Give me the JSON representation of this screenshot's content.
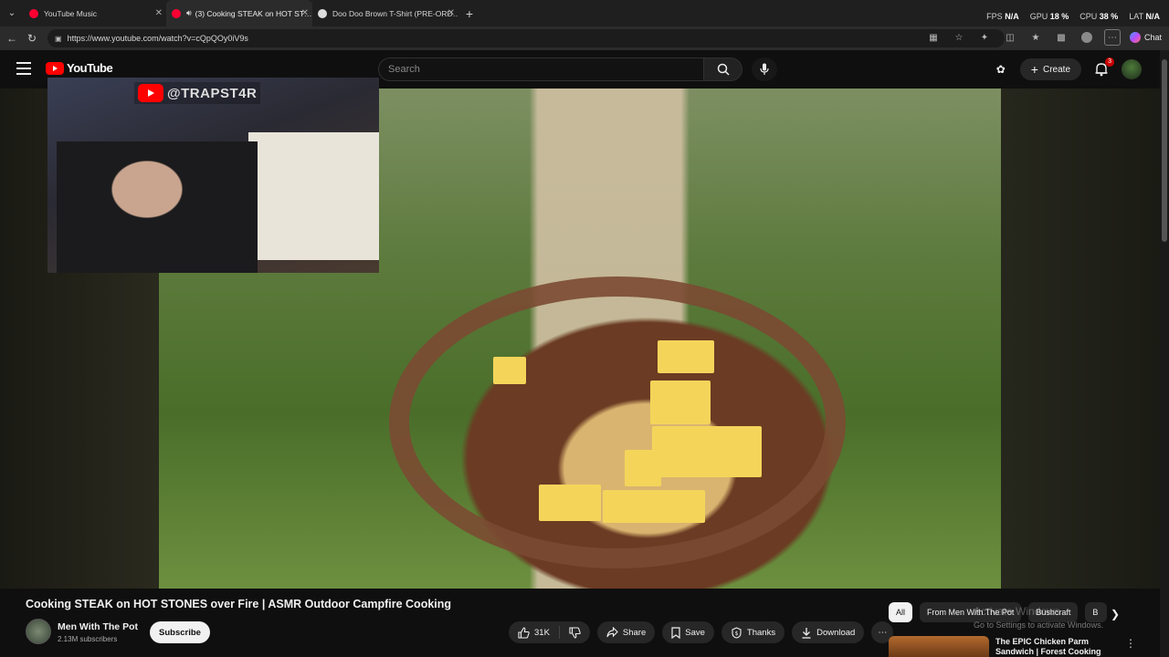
{
  "browser": {
    "tabs": [
      {
        "label": "YouTube Music",
        "active": false,
        "favicon_color": "#ff0033"
      },
      {
        "label": "(3) Cooking STEAK on HOT ST…",
        "active": true,
        "favicon_color": "#ff0033"
      },
      {
        "label": "Doo Doo Brown T-Shirt (PRE-ORD…",
        "active": false,
        "favicon_color": "#dddddd"
      }
    ],
    "url": "https://www.youtube.com/watch?v=cQpQOy0iV9s",
    "perf": {
      "fps_label": "FPS",
      "fps_value": "N/A",
      "gpu_label": "GPU",
      "gpu_value": "18 %",
      "cpu_label": "CPU",
      "cpu_value": "38 %",
      "lat_label": "LAT",
      "lat_value": "N/A"
    },
    "chat_label": "Chat"
  },
  "youtube": {
    "logo_text": "YouTube",
    "search_placeholder": "Search",
    "create_label": "Create",
    "notification_count": "3"
  },
  "overlay": {
    "handle": "@TRAPST4R"
  },
  "video": {
    "title": "Cooking STEAK on HOT STONES over Fire | ASMR Outdoor Campfire Cooking",
    "channel_name": "Men With The Pot",
    "subscribers": "2.13M subscribers",
    "subscribe_label": "Subscribe",
    "likes": "31K",
    "share_label": "Share",
    "save_label": "Save",
    "thanks_label": "Thanks",
    "download_label": "Download"
  },
  "recommendations": {
    "chips": [
      "All",
      "From Men With The Pot",
      "Bushcraft",
      "B"
    ],
    "first_title": "The EPIC Chicken Parm Sandwich | Forest Cooking"
  },
  "windows_watermark": {
    "line1": "Activate Windows",
    "line2": "Go to Settings to activate Windows."
  }
}
